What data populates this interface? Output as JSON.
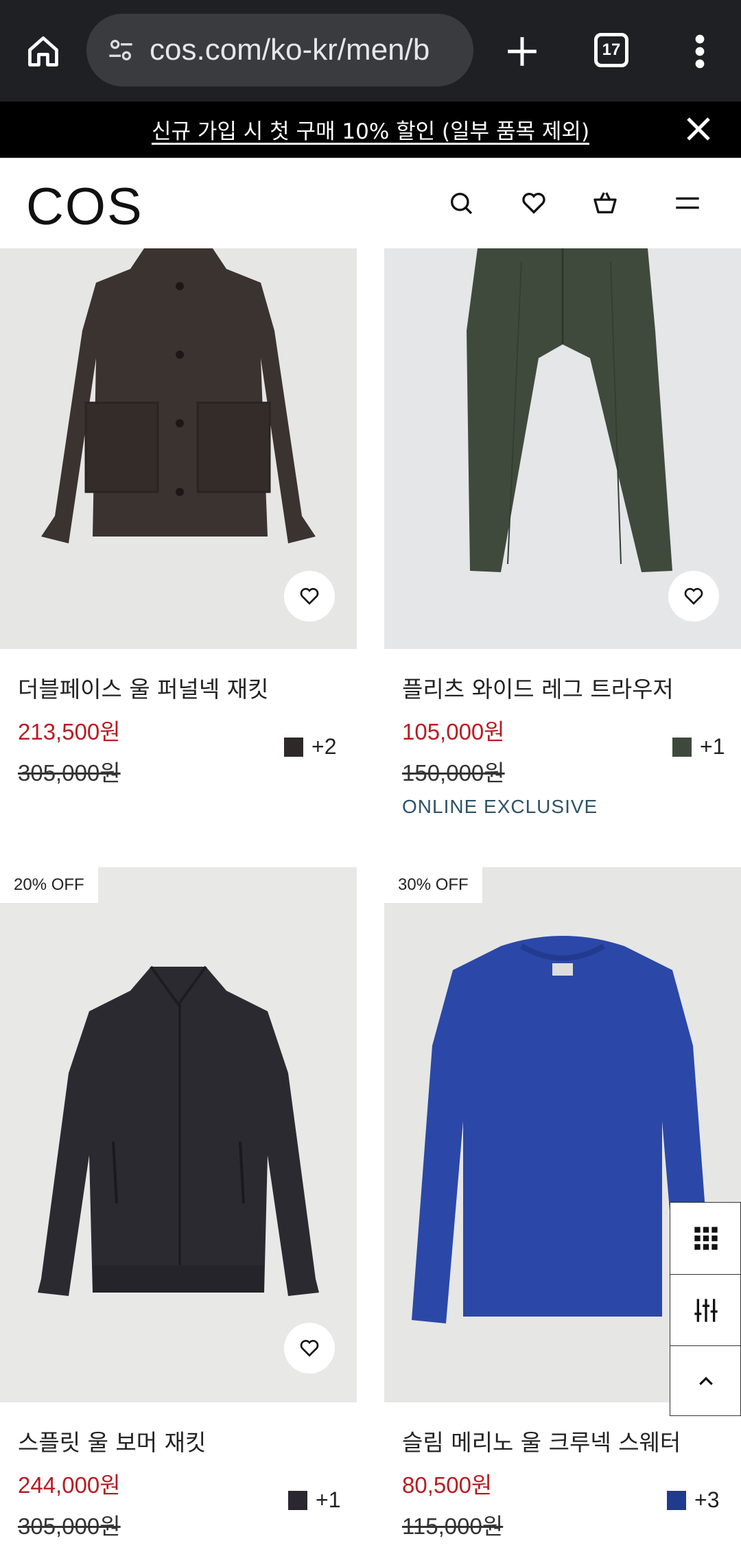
{
  "browser": {
    "url": "cos.com/ko-kr/men/b",
    "tab_count": "17"
  },
  "banner": {
    "text": "신규 가입 시 첫 구매 10% 할인 (일부 품목 제외)"
  },
  "header": {
    "logo": "COS"
  },
  "products": [
    {
      "name": "더블페이스 울 퍼널넥 재킷",
      "sale_price": "213,500원",
      "original_price": "305,000원",
      "swatch_color": "#2e2828",
      "more_colors": "+2",
      "badge": "",
      "label": ""
    },
    {
      "name": "플리츠 와이드 레그 트라우저",
      "sale_price": "105,000원",
      "original_price": "150,000원",
      "swatch_color": "#3d4a3b",
      "more_colors": "+1",
      "badge": "",
      "label": "ONLINE EXCLUSIVE"
    },
    {
      "name": "스플릿 울 보머 재킷",
      "sale_price": "244,000원",
      "original_price": "305,000원",
      "swatch_color": "#2a2730",
      "more_colors": "+1",
      "badge": "20% OFF",
      "label": ""
    },
    {
      "name": "슬림 메리노 울 크루넥 스웨터",
      "sale_price": "80,500원",
      "original_price": "115,000원",
      "swatch_color": "#1f3a8f",
      "more_colors": "+3",
      "badge": "30% OFF",
      "label": ""
    }
  ],
  "colors": {
    "sale": "#b81c22",
    "exclusive": "#2e5168"
  }
}
